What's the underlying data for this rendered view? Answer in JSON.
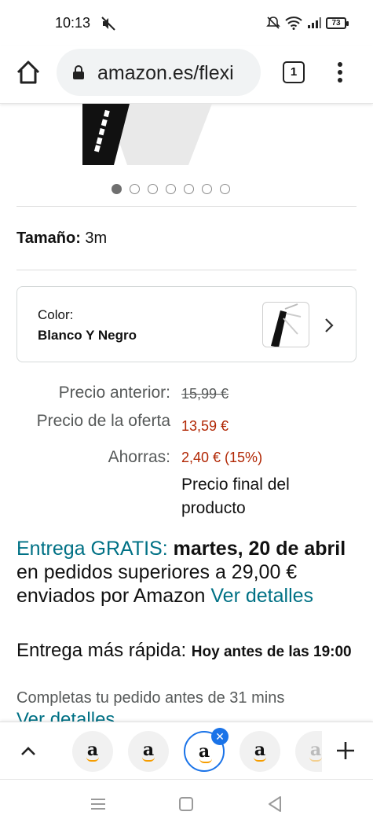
{
  "status_bar": {
    "time": "10:13",
    "battery": "73"
  },
  "browser": {
    "url": "amazon.es/flexi",
    "tab_count": "1"
  },
  "gallery": {
    "dot_count": 7,
    "active_index": 0
  },
  "product": {
    "size_label": "Tamaño:",
    "size_value": "3m",
    "color_label": "Color:",
    "color_value": "Blanco Y Negro"
  },
  "prices": {
    "previous_label": "Precio anterior:",
    "previous_value": "15,99 €",
    "offer_label": "Precio de la oferta",
    "offer_value": "13,59 €",
    "savings_label": "Ahorras:",
    "savings_value": "2,40 € (15%)",
    "final_note": "Precio final del producto"
  },
  "delivery": {
    "free_label": "Entrega GRATIS:",
    "date": "martes, 20 de abril",
    "condition": "en pedidos superiores a 29,00 € enviados por Amazon",
    "details_link": "Ver detalles",
    "fast_label": "Entrega más rápida:",
    "fast_time": "Hoy antes de las 19:00",
    "countdown": "Completas tu pedido antes de 31 mins",
    "details_link_2": "Ver detalles"
  },
  "tab_strip": {
    "tabs": [
      "a",
      "a",
      "a",
      "a",
      "a"
    ],
    "active_index": 2
  },
  "colors": {
    "teal": "#007185",
    "red": "#b12704",
    "chrome_blue": "#1a73e8",
    "amazon_orange": "#f59d00"
  }
}
